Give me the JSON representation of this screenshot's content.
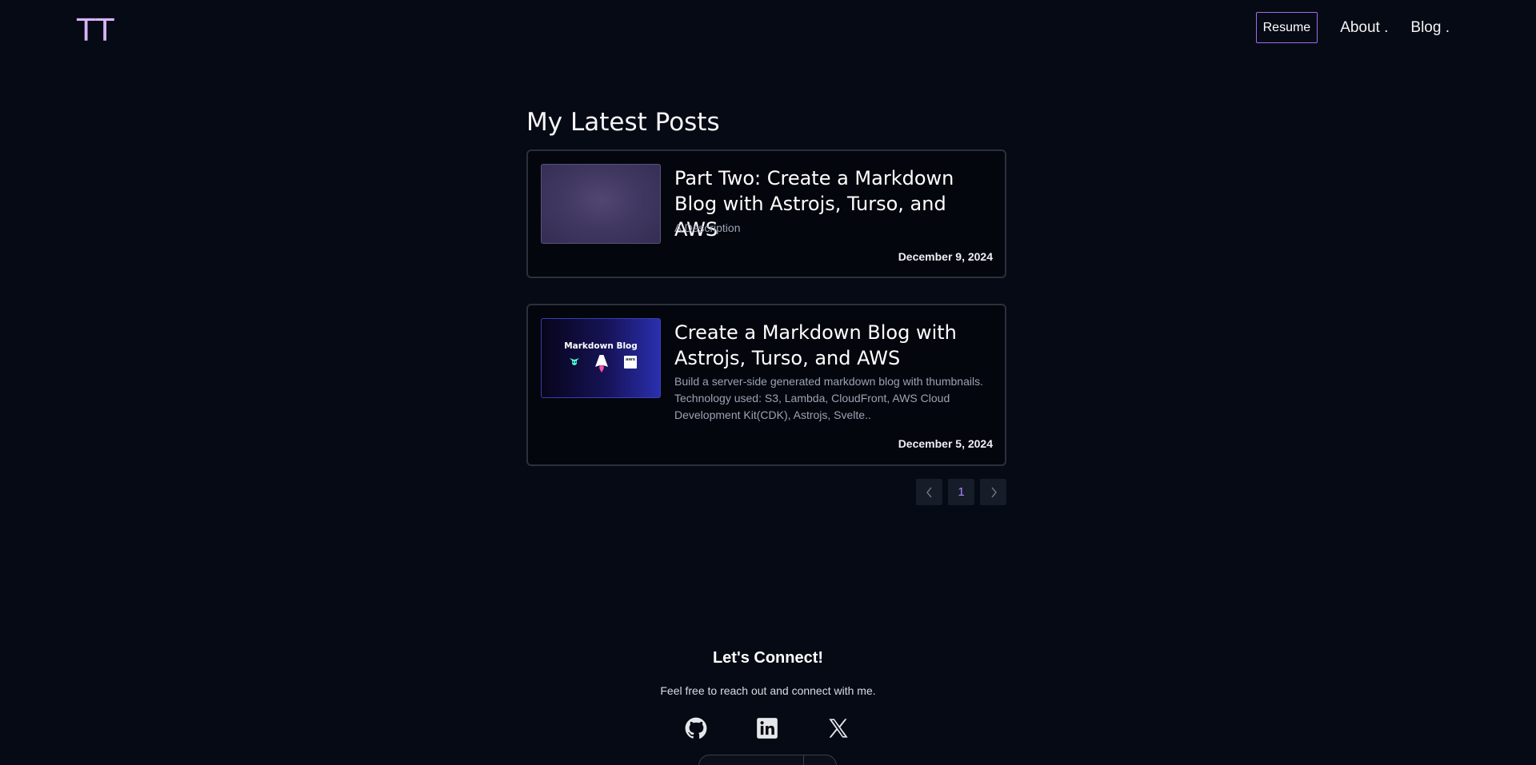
{
  "header": {
    "logo": "TT",
    "nav": {
      "resume_label": "Resume",
      "about_label": "About .",
      "blog_label": "Blog ."
    }
  },
  "main": {
    "section_title": "My Latest Posts",
    "posts": [
      {
        "title": "Part Two: Create a Markdown Blog with Astrojs, Turso, and AWS",
        "description": "A Description",
        "date": "December 9, 2024",
        "thumbnail_text": ""
      },
      {
        "title": "Create a Markdown Blog with Astrojs, Turso, and AWS",
        "description": "Build a server-side generated markdown blog with thumbnails. Technology used: S3, Lambda, CloudFront, AWS Cloud Development Kit(CDK), Astrojs, Svelte..",
        "date": "December 5, 2024",
        "thumbnail_text": "Markdown Blog",
        "thumbnail_icons": [
          "turso-icon",
          "astro-icon",
          "aws-icon"
        ],
        "thumbnail_aws_text": "aws"
      }
    ],
    "pagination": {
      "prev_icon": "chevron-left-icon",
      "current_page": "1",
      "next_icon": "chevron-right-icon"
    }
  },
  "footer": {
    "title": "Let's Connect!",
    "subtitle": "Feel free to reach out and connect with me.",
    "social": [
      "github-icon",
      "linkedin-icon",
      "x-icon"
    ]
  },
  "colors": {
    "background": "#060a14",
    "accent": "#a06cf0",
    "logo": "#d8b4fe",
    "card_border": "#2b303c"
  }
}
